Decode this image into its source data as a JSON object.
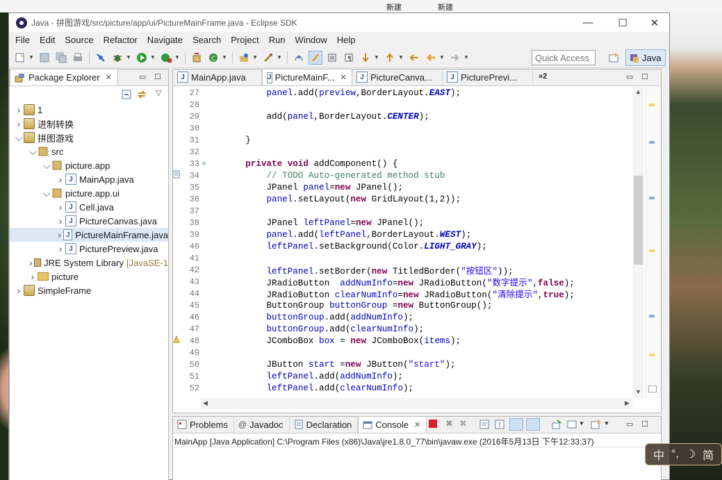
{
  "desktop": {
    "labels": [
      "新建",
      "新建"
    ]
  },
  "window": {
    "title": "Java - 拼图游戏/src/picture/app/ui/PictureMainFrame.java - Eclipse SDK",
    "controls": {
      "minimize": "—",
      "maximize": "☐",
      "close": "✕"
    }
  },
  "menu": [
    "File",
    "Edit",
    "Source",
    "Refactor",
    "Navigate",
    "Search",
    "Project",
    "Run",
    "Window",
    "Help"
  ],
  "toolbar": {
    "quick_access_placeholder": "Quick Access",
    "perspective_label": "Java"
  },
  "explorer": {
    "tab_label": "Package Explorer",
    "tree": [
      {
        "label": "1",
        "extra": "",
        "level": 0,
        "type": "proj",
        "expanded": false
      },
      {
        "label": "进制转换",
        "extra": "",
        "level": 0,
        "type": "proj",
        "expanded": false
      },
      {
        "label": "拼图游戏",
        "extra": "",
        "level": 0,
        "type": "proj",
        "expanded": true
      },
      {
        "label": "src",
        "extra": "",
        "level": 1,
        "type": "srcfolder",
        "expanded": true
      },
      {
        "label": "picture.app",
        "extra": "",
        "level": 2,
        "type": "pkg",
        "expanded": true
      },
      {
        "label": "MainApp.java",
        "extra": "",
        "level": 3,
        "type": "java",
        "expanded": false
      },
      {
        "label": "picture.app.ui",
        "extra": "",
        "level": 2,
        "type": "pkg",
        "expanded": true
      },
      {
        "label": "Cell.java",
        "extra": "",
        "level": 3,
        "type": "java",
        "expanded": false
      },
      {
        "label": "PictureCanvas.java",
        "extra": "",
        "level": 3,
        "type": "java",
        "expanded": false
      },
      {
        "label": "PictureMainFrame.java",
        "extra": "",
        "level": 3,
        "type": "java",
        "expanded": false,
        "selected": true
      },
      {
        "label": "PicturePreview.java",
        "extra": "",
        "level": 3,
        "type": "java",
        "expanded": false
      },
      {
        "label": "JRE System Library",
        "extra": "[JavaSE-1",
        "level": 1,
        "type": "lib",
        "expanded": false
      },
      {
        "label": "picture",
        "extra": "",
        "level": 1,
        "type": "folder",
        "expanded": false
      },
      {
        "label": "SimpleFrame",
        "extra": "",
        "level": 0,
        "type": "proj",
        "expanded": false
      }
    ]
  },
  "editor": {
    "tabs": [
      {
        "label": "MainApp.java",
        "active": false
      },
      {
        "label": "PictureMainF...",
        "active": true
      },
      {
        "label": "PictureCanva...",
        "active": false
      },
      {
        "label": "PicturePrevi...",
        "active": false
      }
    ],
    "overflow_count": "»2",
    "lines": [
      {
        "n": "27",
        "tokens": [
          [
            "t",
            "        "
          ],
          [
            "f",
            "panel"
          ],
          [
            "t",
            ".add("
          ],
          [
            "f",
            "preview"
          ],
          [
            "t",
            ",BorderLayout."
          ],
          [
            "c",
            "EAST"
          ],
          [
            "t",
            ");"
          ]
        ]
      },
      {
        "n": "28",
        "tokens": []
      },
      {
        "n": "29",
        "tokens": [
          [
            "t",
            "        add("
          ],
          [
            "f",
            "panel"
          ],
          [
            "t",
            ",BorderLayout."
          ],
          [
            "c",
            "CENTER"
          ],
          [
            "t",
            ");"
          ]
        ]
      },
      {
        "n": "30",
        "tokens": []
      },
      {
        "n": "31",
        "tokens": [
          [
            "t",
            "    }"
          ]
        ]
      },
      {
        "n": "32",
        "tokens": []
      },
      {
        "n": "33",
        "tokens": [
          [
            "k",
            "    private void"
          ],
          [
            "t",
            " addComponent() {"
          ]
        ],
        "marker": "fold"
      },
      {
        "n": "34",
        "tokens": [
          [
            "m",
            "        // TODO Auto-generated method stub"
          ]
        ],
        "marker": "task"
      },
      {
        "n": "35",
        "tokens": [
          [
            "t",
            "        JPanel "
          ],
          [
            "f",
            "panel"
          ],
          [
            "t",
            "="
          ],
          [
            "k",
            "new"
          ],
          [
            "t",
            " JPanel();"
          ]
        ]
      },
      {
        "n": "36",
        "tokens": [
          [
            "t",
            "        "
          ],
          [
            "f",
            "panel"
          ],
          [
            "t",
            ".setLayout("
          ],
          [
            "k",
            "new"
          ],
          [
            "t",
            " GridLayout(1,2));"
          ]
        ]
      },
      {
        "n": "37",
        "tokens": []
      },
      {
        "n": "38",
        "tokens": [
          [
            "t",
            "        JPanel "
          ],
          [
            "f",
            "leftPanel"
          ],
          [
            "t",
            "="
          ],
          [
            "k",
            "new"
          ],
          [
            "t",
            " JPanel();"
          ]
        ]
      },
      {
        "n": "39",
        "tokens": [
          [
            "t",
            "        "
          ],
          [
            "f",
            "panel"
          ],
          [
            "t",
            ".add("
          ],
          [
            "f",
            "leftPanel"
          ],
          [
            "t",
            ",BorderLayout."
          ],
          [
            "c",
            "WEST"
          ],
          [
            "t",
            ");"
          ]
        ]
      },
      {
        "n": "40",
        "tokens": [
          [
            "t",
            "        "
          ],
          [
            "f",
            "leftPanel"
          ],
          [
            "t",
            ".setBackground(Color."
          ],
          [
            "c",
            "LIGHT_GRAY"
          ],
          [
            "t",
            ");"
          ]
        ]
      },
      {
        "n": "41",
        "tokens": []
      },
      {
        "n": "42",
        "tokens": [
          [
            "t",
            "        "
          ],
          [
            "f",
            "leftPanel"
          ],
          [
            "t",
            ".setBorder("
          ],
          [
            "k",
            "new"
          ],
          [
            "t",
            " TitledBorder("
          ],
          [
            "s",
            "\"按钮区\""
          ],
          [
            "t",
            "));"
          ]
        ]
      },
      {
        "n": "43",
        "tokens": [
          [
            "t",
            "        JRadioButton  "
          ],
          [
            "f",
            "addNumInfo"
          ],
          [
            "t",
            "="
          ],
          [
            "k",
            "new"
          ],
          [
            "t",
            " JRadioButton("
          ],
          [
            "s",
            "\"数字提示\""
          ],
          [
            "t",
            ","
          ],
          [
            "k",
            "false"
          ],
          [
            "t",
            ");"
          ]
        ]
      },
      {
        "n": "44",
        "tokens": [
          [
            "t",
            "        JRadioButton "
          ],
          [
            "f",
            "clearNumInfo"
          ],
          [
            "t",
            "="
          ],
          [
            "k",
            "new"
          ],
          [
            "t",
            " JRadioButton("
          ],
          [
            "s",
            "\"清除提示\""
          ],
          [
            "t",
            ","
          ],
          [
            "k",
            "true"
          ],
          [
            "t",
            ");"
          ]
        ]
      },
      {
        "n": "45",
        "tokens": [
          [
            "t",
            "        ButtonGroup "
          ],
          [
            "f",
            "buttonGroup"
          ],
          [
            "t",
            " ="
          ],
          [
            "k",
            "new"
          ],
          [
            "t",
            " ButtonGroup();"
          ]
        ]
      },
      {
        "n": "46",
        "tokens": [
          [
            "t",
            "        "
          ],
          [
            "f",
            "buttonGroup"
          ],
          [
            "t",
            ".add("
          ],
          [
            "f",
            "addNumInfo"
          ],
          [
            "t",
            ");"
          ]
        ]
      },
      {
        "n": "47",
        "tokens": [
          [
            "t",
            "        "
          ],
          [
            "f",
            "buttonGroup"
          ],
          [
            "t",
            ".add("
          ],
          [
            "f",
            "clearNumInfo"
          ],
          [
            "t",
            ");"
          ]
        ]
      },
      {
        "n": "48",
        "tokens": [
          [
            "t",
            "        JComboBox "
          ],
          [
            "f",
            "box"
          ],
          [
            "t",
            " = "
          ],
          [
            "k",
            "new"
          ],
          [
            "t",
            " JComboBox("
          ],
          [
            "f",
            "items"
          ],
          [
            "t",
            ");"
          ]
        ],
        "marker": "warn"
      },
      {
        "n": "49",
        "tokens": []
      },
      {
        "n": "50",
        "tokens": [
          [
            "t",
            "        JButton "
          ],
          [
            "f",
            "start"
          ],
          [
            "t",
            " ="
          ],
          [
            "k",
            "new"
          ],
          [
            "t",
            " JButton("
          ],
          [
            "s",
            "\"start\""
          ],
          [
            "t",
            ");"
          ]
        ]
      },
      {
        "n": "51",
        "tokens": [
          [
            "t",
            "        "
          ],
          [
            "f",
            "leftPanel"
          ],
          [
            "t",
            ".add("
          ],
          [
            "f",
            "addNumInfo"
          ],
          [
            "t",
            ");"
          ]
        ]
      },
      {
        "n": "52",
        "tokens": [
          [
            "t",
            "        "
          ],
          [
            "f",
            "leftPanel"
          ],
          [
            "t",
            ".add("
          ],
          [
            "f",
            "clearNumInfo"
          ],
          [
            "t",
            ");"
          ]
        ]
      }
    ]
  },
  "console": {
    "tabs": [
      {
        "label": "Problems",
        "icon": "problems-icon",
        "active": false
      },
      {
        "label": "Javadoc",
        "icon": "javadoc-icon",
        "active": false
      },
      {
        "label": "Declaration",
        "icon": "declaration-icon",
        "active": false
      },
      {
        "label": "Console",
        "icon": "console-icon",
        "active": true
      }
    ],
    "description": "MainApp [Java Application] C:\\Program Files (x86)\\Java\\jre1.8.0_77\\bin\\javaw.exe (2016年5月13日 下午12:33:37)"
  },
  "ime": {
    "items": [
      "中",
      "°,",
      "☽",
      "简"
    ]
  },
  "colors": {
    "keyword": "#7f0055",
    "comment": "#3f7f5f",
    "string": "#2a00ff",
    "field": "#0000c0",
    "selection": "#dde8f4"
  }
}
